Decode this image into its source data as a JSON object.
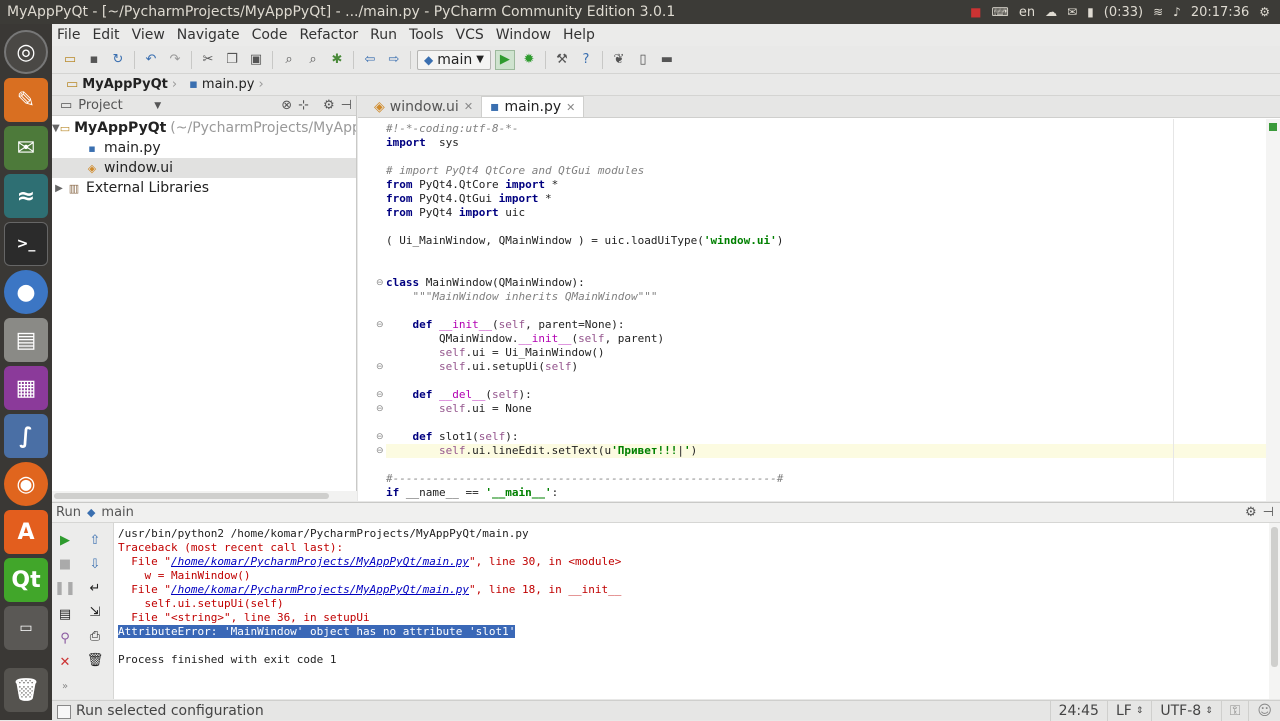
{
  "window": {
    "title": "MyAppPyQt - [~/PycharmProjects/MyAppPyQt] - .../main.py - PyCharm Community Edition 3.0.1"
  },
  "tray": {
    "lang": "en",
    "battery": "(0:33)",
    "clock": "20:17:36"
  },
  "menu": [
    "File",
    "Edit",
    "View",
    "Navigate",
    "Code",
    "Refactor",
    "Run",
    "Tools",
    "VCS",
    "Window",
    "Help"
  ],
  "toolbar": {
    "run_config": "main"
  },
  "breadcrumb": {
    "project": "MyAppPyQt",
    "file": "main.py"
  },
  "project_panel": {
    "title": "Project",
    "items": [
      {
        "label": "MyAppPyQt",
        "extra": "(~/PycharmProjects/MyAppP",
        "bold": true
      },
      {
        "label": "main.py"
      },
      {
        "label": "window.ui"
      },
      {
        "label": "External Libraries"
      }
    ]
  },
  "tabs": [
    {
      "label": "window.ui"
    },
    {
      "label": "main.py"
    }
  ],
  "code": [
    {
      "t": [
        [
          "cm",
          "#!-*-coding:utf-8-*-"
        ]
      ]
    },
    {
      "t": [
        [
          "kw",
          "import"
        ],
        [
          "",
          "  sys"
        ]
      ]
    },
    {
      "t": []
    },
    {
      "t": [
        [
          "cm",
          "# import PyQt4 QtCore and QtGui modules"
        ]
      ]
    },
    {
      "t": [
        [
          "kw",
          "from"
        ],
        [
          "",
          " PyQt4.QtCore "
        ],
        [
          "kw",
          "import"
        ],
        [
          "",
          " *"
        ]
      ]
    },
    {
      "t": [
        [
          "kw",
          "from"
        ],
        [
          "",
          " PyQt4.QtGui "
        ],
        [
          "kw",
          "import"
        ],
        [
          "",
          " *"
        ]
      ]
    },
    {
      "t": [
        [
          "kw",
          "from"
        ],
        [
          "",
          " PyQt4 "
        ],
        [
          "kw",
          "import"
        ],
        [
          "",
          " uic"
        ]
      ]
    },
    {
      "t": []
    },
    {
      "t": [
        [
          "",
          "( Ui_MainWindow, QMainWindow ) = uic.loadUiType("
        ],
        [
          "st",
          "'window.ui'"
        ],
        [
          "",
          ")"
        ]
      ]
    },
    {
      "t": []
    },
    {
      "t": []
    },
    {
      "t": [
        [
          "kw",
          "class"
        ],
        [
          "",
          " MainWindow(QMainWindow):"
        ]
      ]
    },
    {
      "t": [
        [
          "",
          "    "
        ],
        [
          "ds",
          "\"\"\"MainWindow inherits QMainWindow\"\"\""
        ]
      ]
    },
    {
      "t": []
    },
    {
      "t": [
        [
          "",
          "    "
        ],
        [
          "kw",
          "def"
        ],
        [
          "",
          " "
        ],
        [
          "dm",
          "__init__"
        ],
        [
          "",
          "("
        ],
        [
          "sf",
          "self"
        ],
        [
          "",
          ", parent=None):"
        ]
      ]
    },
    {
      "t": [
        [
          "",
          "        QMainWindow."
        ],
        [
          "dm",
          "__init__"
        ],
        [
          "",
          "("
        ],
        [
          "sf",
          "self"
        ],
        [
          "",
          ", parent)"
        ]
      ]
    },
    {
      "t": [
        [
          "",
          "        "
        ],
        [
          "sf",
          "self"
        ],
        [
          "",
          ".ui = Ui_MainWindow()"
        ]
      ]
    },
    {
      "t": [
        [
          "",
          "        "
        ],
        [
          "sf",
          "self"
        ],
        [
          "",
          ".ui.setupUi("
        ],
        [
          "sf",
          "self"
        ],
        [
          "",
          ")"
        ]
      ]
    },
    {
      "t": []
    },
    {
      "t": [
        [
          "",
          "    "
        ],
        [
          "kw",
          "def"
        ],
        [
          "",
          " "
        ],
        [
          "dm",
          "__del__"
        ],
        [
          "",
          "("
        ],
        [
          "sf",
          "self"
        ],
        [
          "",
          "):"
        ]
      ]
    },
    {
      "t": [
        [
          "",
          "        "
        ],
        [
          "sf",
          "self"
        ],
        [
          "",
          ".ui = None"
        ]
      ]
    },
    {
      "t": []
    },
    {
      "t": [
        [
          "",
          "    "
        ],
        [
          "kw",
          "def"
        ],
        [
          "",
          " slot1("
        ],
        [
          "sf",
          "self"
        ],
        [
          "",
          "):"
        ]
      ]
    },
    {
      "t": [
        [
          "",
          "        "
        ],
        [
          "sf",
          "self"
        ],
        [
          "",
          ".ui.lineEdit.setText(u"
        ],
        [
          "st",
          "'Привет!!!"
        ],
        [
          "",
          "|"
        ],
        [
          "st",
          "'"
        ],
        [
          "",
          ")"
        ]
      ],
      "cur": true
    },
    {
      "t": []
    },
    {
      "t": [
        [
          "cm",
          "#----------------------------------------------------------#"
        ]
      ]
    },
    {
      "t": [
        [
          "kw",
          "if"
        ],
        [
          "",
          " __name__ == "
        ],
        [
          "st",
          "'__main__'"
        ],
        [
          "",
          ":"
        ]
      ]
    }
  ],
  "run_panel": {
    "title": "Run",
    "config": "main",
    "output": [
      {
        "t": [
          [
            "",
            "/usr/bin/python2 /home/komar/PycharmProjects/MyAppPyQt/main.py"
          ]
        ]
      },
      {
        "t": [
          [
            "err",
            "Traceback (most recent call last):"
          ]
        ]
      },
      {
        "t": [
          [
            "err",
            "  File \""
          ],
          [
            "lnk",
            "/home/komar/PycharmProjects/MyAppPyQt/main.py"
          ],
          [
            "err",
            "\", line 30, in <module>"
          ]
        ]
      },
      {
        "t": [
          [
            "err",
            "    w = MainWindow()"
          ]
        ]
      },
      {
        "t": [
          [
            "err",
            "  File \""
          ],
          [
            "lnk",
            "/home/komar/PycharmProjects/MyAppPyQt/main.py"
          ],
          [
            "err",
            "\", line 18, in __init__"
          ]
        ]
      },
      {
        "t": [
          [
            "err",
            "    self.ui.setupUi(self)"
          ]
        ]
      },
      {
        "t": [
          [
            "err",
            "  File \"<string>\", line 36, in setupUi"
          ]
        ]
      },
      {
        "t": [
          [
            "hl",
            "AttributeError: 'MainWindow' object has no attribute 'slot1'"
          ]
        ]
      },
      {
        "t": []
      },
      {
        "t": [
          [
            "",
            "Process finished with exit code 1"
          ]
        ]
      }
    ]
  },
  "status": {
    "message": "Run selected configuration",
    "position": "24:45",
    "line_sep": "LF",
    "encoding": "UTF-8"
  }
}
